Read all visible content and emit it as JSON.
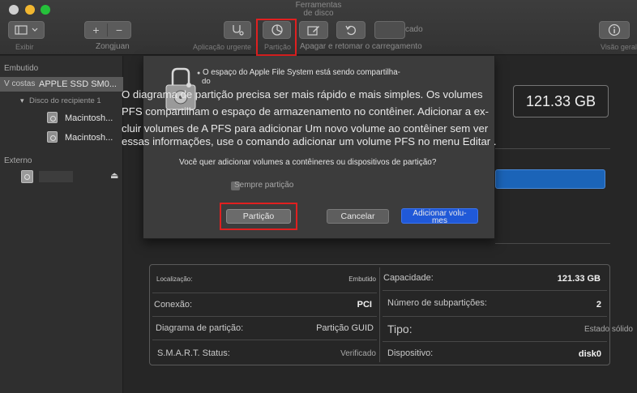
{
  "window": {
    "title_line1": "Ferramentas",
    "title_line2": "de disco"
  },
  "toolbar": {
    "view_label": "Exibir",
    "volume_label": "Zongjuan",
    "first_aid_label": "Aplicação urgente",
    "partition_label": "Partição",
    "erase_label": "Apagar e retomar o carregamento",
    "mount_fragment": "cado",
    "info_label": "Visão geral"
  },
  "sidebar": {
    "internal_header": "Embutido",
    "drive_prefix": "V costas",
    "drive_name": "APPLE SSD SM0...",
    "container": "Disco do recipiente 1",
    "volumes": [
      "Macintosh...",
      "Macintosh..."
    ],
    "external_header": "Externo"
  },
  "dialog": {
    "apfs_line1": "O espaço do Apple File System está sendo compartilha-",
    "apfs_line2": "do",
    "overlay_lines": [
      "O diagrama de partição precisa ser mais rápido e mais simples. Os volumes",
      "PFS compartilham o espaço de armazenamento no contêiner. Adicionar a ex-",
      "cluir volumes de A PFS para adicionar Um novo volume ao contêiner sem ver",
      "essas informações, use o comando adicionar um volume PFS no menu Editar ."
    ],
    "question": "Você quer adicionar volumes a contêineres ou dispositivos de partição?",
    "checkbox_label": "Sempre partição",
    "partition_button": "Partição",
    "cancel_button": "Cancelar",
    "add_button_line1": "Adicionar volu-",
    "add_button_line2": "mes"
  },
  "main": {
    "capacity_display": "121.33 GB"
  },
  "info": {
    "location_label": "Localização:",
    "location_value": "Embutido",
    "capacity_label": "Capacidade:",
    "capacity_value": "121.33 GB",
    "connection_label": "Conexão:",
    "connection_value": "PCI",
    "subpart_label": "Número de subpartições:",
    "subpart_value": "2",
    "scheme_label": "Diagrama de partição:",
    "scheme_value": "Partição GUID",
    "type_label": "Tipo:",
    "type_value": "Estado sólido",
    "smart_label": "S.M.A.R.T. Status:",
    "smart_value": "Verificado",
    "device_label": "Dispositivo:",
    "device_value": "disk0"
  },
  "colors": {
    "highlight_box": "#e02020",
    "primary_button": "#2059d8",
    "progress_blue": "#1b64b8"
  }
}
